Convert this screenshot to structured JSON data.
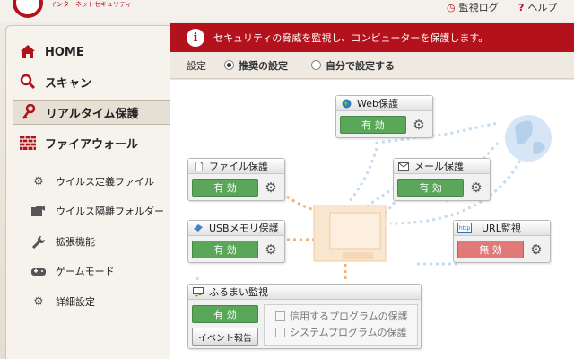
{
  "header": {
    "logo_subtitle": "インターネットセキュリティ",
    "log_label": "監視ログ",
    "help_label": "ヘルプ"
  },
  "sidebar": {
    "main_items": [
      {
        "label": "HOME",
        "icon": "home-icon"
      },
      {
        "label": "スキャン",
        "icon": "magnifier-icon"
      },
      {
        "label": "リアルタイム保護",
        "icon": "key-icon",
        "active": true
      },
      {
        "label": "ファイアウォール",
        "icon": "brick-wall-icon"
      }
    ],
    "sub_items": [
      {
        "label": "ウイルス定義ファイル",
        "icon": "gears-icon"
      },
      {
        "label": "ウイルス隔離フォルダー",
        "icon": "folder-arrow-icon"
      },
      {
        "label": "拡張機能",
        "icon": "wrench-icon"
      },
      {
        "label": "ゲームモード",
        "icon": "gamepad-icon"
      },
      {
        "label": "詳細設定",
        "icon": "gear-icon"
      }
    ]
  },
  "banner": {
    "message": "セキュリティの脅威を監視し、コンピューターを保護します。"
  },
  "settings": {
    "label": "設定",
    "option_recommended": "推奨の設定",
    "option_custom": "自分で設定する",
    "selected": "recommended"
  },
  "modules": {
    "web": {
      "title": "Web保護",
      "status": "有 効"
    },
    "file": {
      "title": "ファイル保護",
      "status": "有 効"
    },
    "mail": {
      "title": "メール保護",
      "status": "有 効"
    },
    "usb": {
      "title": "USBメモリ保護",
      "status": "有 効"
    },
    "url": {
      "title": "URL監視",
      "status": "無 効",
      "url_badge": "http"
    },
    "behavior": {
      "title": "ふるまい監視",
      "status": "有 効",
      "event_button": "イベント報告",
      "check_trusted": "信用するプログラムの保護",
      "check_system": "システムプログラムの保護"
    }
  },
  "colors": {
    "accent": "#b3121c",
    "enabled": "#5aa75a",
    "disabled": "#e07a78",
    "flow_line": "#c5dcef",
    "flow_line_orange": "#f0b27a"
  }
}
